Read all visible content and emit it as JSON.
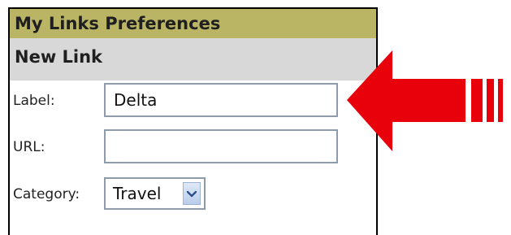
{
  "panel": {
    "title": "My Links Preferences",
    "section_title": "New Link"
  },
  "form": {
    "label_field": {
      "label": "Label:",
      "value": "Delta",
      "placeholder": ""
    },
    "url_field": {
      "label": "URL:",
      "value": "",
      "placeholder": ""
    },
    "category_field": {
      "label": "Category:",
      "selected": "Travel"
    }
  },
  "icons": {
    "select_arrow": "chevron-down-icon",
    "pointer_arrow": "left-arrow-icon"
  },
  "colors": {
    "header_bg": "#bab465",
    "section_bg": "#d8d8d8",
    "arrow_red": "#e8000b",
    "input_border": "#8e9bab"
  }
}
